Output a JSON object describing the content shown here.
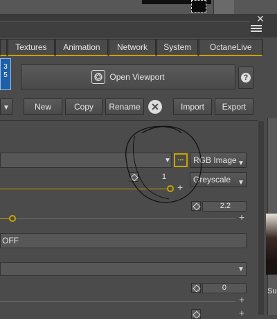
{
  "tabs": [
    "Textures",
    "Animation",
    "Network",
    "System",
    "OctaneLive"
  ],
  "side_text": [
    "3",
    "5"
  ],
  "toolbar": {
    "open_viewport": "Open Viewport",
    "help": "?",
    "new": "New",
    "copy": "Copy",
    "rename": "Rename",
    "import": "Import",
    "export": "Export"
  },
  "rows": {
    "dots": "•••",
    "rgb_image": "RGB Image",
    "power_value": "1",
    "greyscale": "Greyscale",
    "gamma_value": "2.2",
    "off_label": "OFF",
    "zero_value": "0"
  },
  "right_panel": {
    "label": "Su"
  },
  "colors": {
    "accent": "#c9a200",
    "panel": "#4b4b4b",
    "blue_tile": "#1e5fa8"
  }
}
